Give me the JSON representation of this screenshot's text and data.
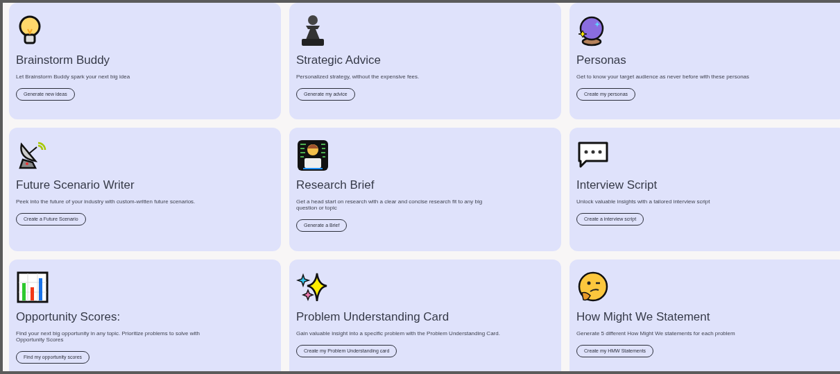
{
  "cards": [
    {
      "kind": "bulb",
      "title": "Brainstorm Buddy",
      "description": "Let Brainstorm Buddy spark your next big idea",
      "button": "Generate new ideas"
    },
    {
      "kind": "pawn",
      "title": "Strategic Advice",
      "description": "Personalized strategy, without the expensive fees.",
      "button": "Generate my advice"
    },
    {
      "kind": "crystal-ball",
      "title": "Personas",
      "description": "Get to know your target audience as never before with these personas",
      "button": "Create my personas"
    },
    {
      "kind": "satellite",
      "title": "Future Scenario Writer",
      "description": "Peek into the future of your industry with custom-written future scenarios.",
      "button": "Create a Future Scenario"
    },
    {
      "kind": "coder",
      "title": "Research Brief",
      "description": "Get a head start on research with a clear and concise research fit to any big question or topic",
      "button": "Generate a Brief"
    },
    {
      "kind": "speech",
      "title": "Interview Script",
      "description": "Unlock valuable insights with a tailored interview script",
      "button": "Create a interview script"
    },
    {
      "kind": "chart",
      "title": "Opportunity Scores:",
      "description": "Find your next big opportunity in any topic. Prioritize problems to solve with Opportunity Scores",
      "button": "Find my opportunity scores"
    },
    {
      "kind": "sparkles",
      "title": "Problem Understanding Card",
      "description": "Gain valuable insight into a specific problem with the Problem Understanding Card.",
      "button": "Create my Problem Understanding card"
    },
    {
      "kind": "thinking",
      "title": "How Might We Statement",
      "description": "Generate 5 different How Might We statements for each problem",
      "button": "Create my HMW Statements"
    }
  ]
}
